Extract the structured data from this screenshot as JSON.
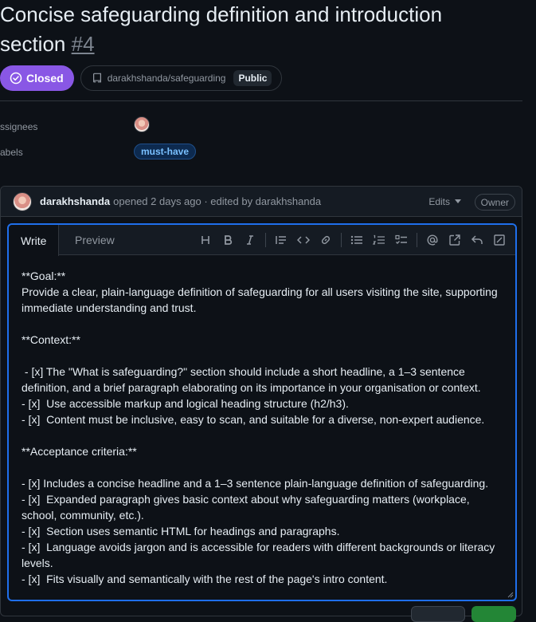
{
  "issue": {
    "title": "Concise safeguarding definition and introduction section",
    "number": "#4",
    "state": "Closed",
    "repo": "darakhshanda/safeguarding",
    "visibility": "Public"
  },
  "sidebar": {
    "assignees_label": "ssignees",
    "labels_label": "abels",
    "label_tag": "must-have"
  },
  "comment": {
    "author": "darakhshanda",
    "meta": "opened 2 days ago · edited by darakhshanda",
    "edits_label": "Edits",
    "role_tag": "Owner"
  },
  "editor": {
    "tab_write": "Write",
    "tab_preview": "Preview",
    "tools": [
      "heading-icon",
      "bold-icon",
      "italic-icon",
      "quote-icon",
      "code-icon",
      "link-icon",
      "unordered-list-icon",
      "ordered-list-icon",
      "task-list-icon",
      "mention-icon",
      "reference-icon",
      "undo-icon",
      "fullscreen-icon"
    ],
    "body": "**Goal:**\nProvide a clear, plain-language definition of safeguarding for all users visiting the site, supporting immediate understanding and trust.\n\n**Context:**\n\n - [x] The \"What is safeguarding?\" section should include a short headline, a 1–3 sentence definition, and a brief paragraph elaborating on its importance in your organisation or context.\n- [x]  Use accessible markup and logical heading structure (h2/h3).\n- [x]  Content must be inclusive, easy to scan, and suitable for a diverse, non-expert audience.\n\n**Acceptance criteria:**\n\n- [x] Includes a concise headline and a 1–3 sentence plain-language definition of safeguarding.\n- [x]  Expanded paragraph gives basic context about why safeguarding matters (workplace, school, community, etc.).\n- [x]  Section uses semantic HTML for headings and paragraphs.\n- [x]  Language avoids jargon and is accessible for readers with different backgrounds or literacy levels.\n- [x]  Fits visually and semantically with the rest of the page's intro content."
  },
  "colors": {
    "closed": "#8957e5",
    "focus": "#1f6feb",
    "label_text": "#79c0ff"
  }
}
